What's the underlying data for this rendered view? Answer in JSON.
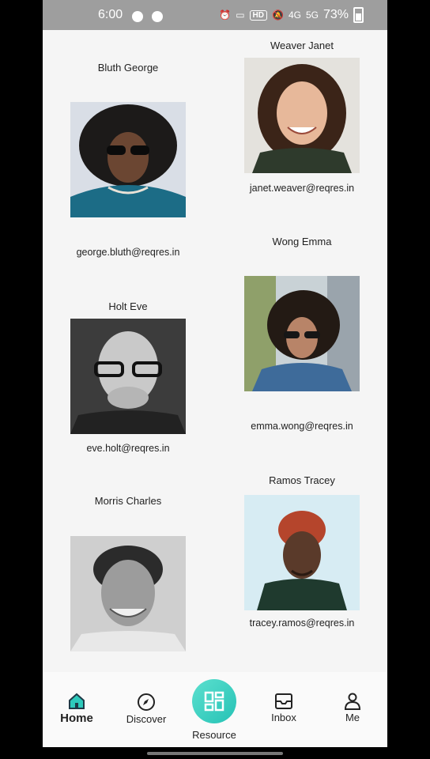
{
  "status_bar": {
    "time": "6:00",
    "hd_badge": "HD",
    "network_1": "4G",
    "network_2": "5G",
    "battery": "73%"
  },
  "users": [
    {
      "name": "Bluth George",
      "email": "george.bluth@reqres.in"
    },
    {
      "name": "Weaver Janet",
      "email": "janet.weaver@reqres.in"
    },
    {
      "name": "Wong Emma",
      "email": "emma.wong@reqres.in"
    },
    {
      "name": "Holt Eve",
      "email": "eve.holt@reqres.in"
    },
    {
      "name": "Morris Charles",
      "email": ""
    },
    {
      "name": "Ramos Tracey",
      "email": "tracey.ramos@reqres.in"
    }
  ],
  "nav": {
    "home": "Home",
    "discover": "Discover",
    "resource": "Resource",
    "inbox": "Inbox",
    "me": "Me"
  },
  "colors": {
    "accent": "#2ec9bb",
    "status_bar": "#9e9e9e"
  }
}
